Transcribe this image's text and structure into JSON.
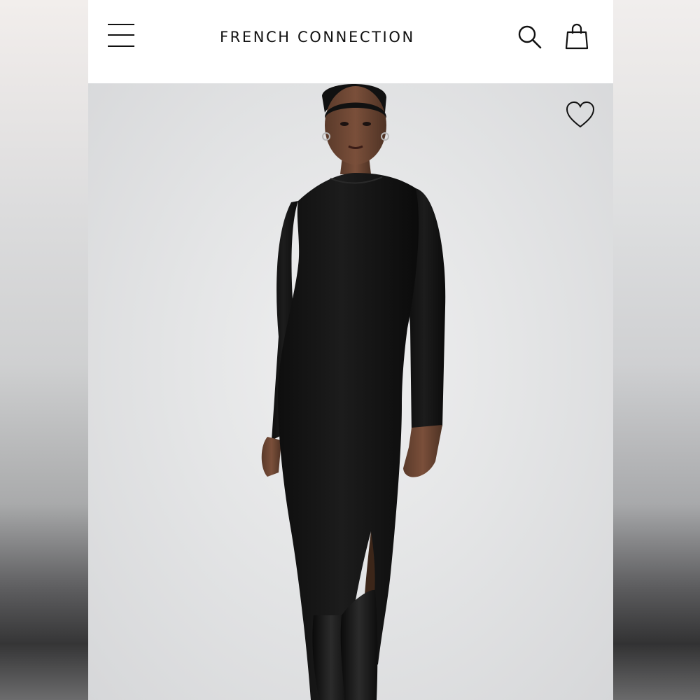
{
  "header": {
    "brand": "FRENCH CONNECTION",
    "menu_icon": "hamburger-menu-icon",
    "search_icon": "search-icon",
    "bag_icon": "shopping-bag-icon"
  },
  "product": {
    "image": "model wearing black long-sleeve knit midi dress with side slit and black knee-high boots",
    "wishlist_icon": "heart-outline-icon"
  },
  "colors": {
    "header_bg": "#ffffff",
    "text": "#111111",
    "image_bg": "#e4e5e6",
    "dress": "#141414"
  }
}
